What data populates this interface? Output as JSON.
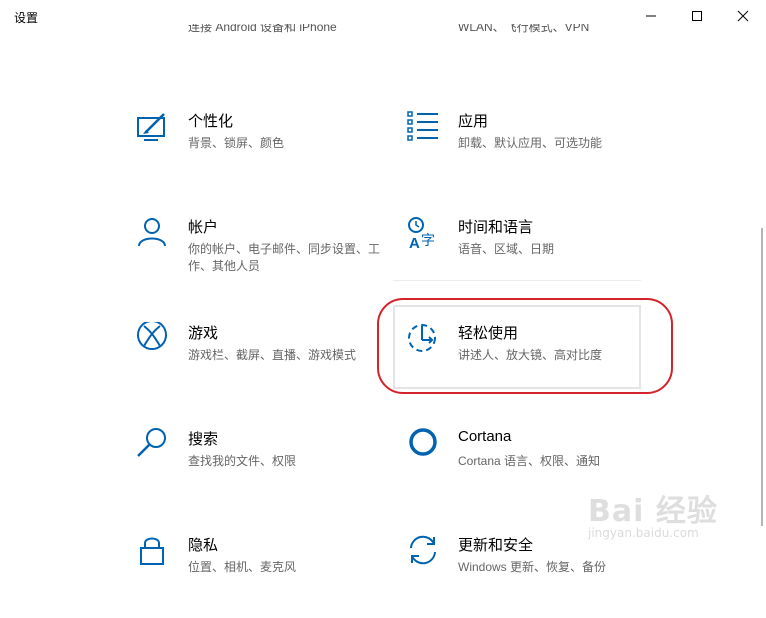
{
  "window": {
    "title": "设置",
    "controls": {
      "minimize_icon": "minimize-icon",
      "maximize_icon": "maximize-icon",
      "close_icon": "close-icon"
    }
  },
  "partial_row": {
    "left_desc": "连接 Android 设备和 iPhone",
    "right_desc": "WLAN、飞行模式、VPN"
  },
  "tiles": [
    {
      "name": "个性化",
      "desc": "背景、锁屏、颜色",
      "icon": "personalization-icon"
    },
    {
      "name": "应用",
      "desc": "卸载、默认应用、可选功能",
      "icon": "apps-icon"
    },
    {
      "name": "帐户",
      "desc": "你的帐户、电子邮件、同步设置、工作、其他人员",
      "icon": "account-icon"
    },
    {
      "name": "时间和语言",
      "desc": "语音、区域、日期",
      "icon": "time-language-icon"
    },
    {
      "name": "游戏",
      "desc": "游戏栏、截屏、直播、游戏模式",
      "icon": "xbox-icon"
    },
    {
      "name": "轻松使用",
      "desc": "讲述人、放大镜、高对比度",
      "icon": "ease-of-access-icon"
    },
    {
      "name": "搜索",
      "desc": "查找我的文件、权限",
      "icon": "search-icon"
    },
    {
      "name": "Cortana",
      "desc": "Cortana 语言、权限、通知",
      "icon": "cortana-icon"
    },
    {
      "name": "隐私",
      "desc": "位置、相机、麦克风",
      "icon": "privacy-lock-icon"
    },
    {
      "name": "更新和安全",
      "desc": "Windows 更新、恢复、备份",
      "icon": "update-sync-icon"
    }
  ],
  "watermark": {
    "text": "Bai 经验",
    "sub": "jingyan.baidu.com"
  },
  "colors": {
    "accent": "#0063b1",
    "annotation": "#d4232a",
    "desc_text": "#666666"
  }
}
